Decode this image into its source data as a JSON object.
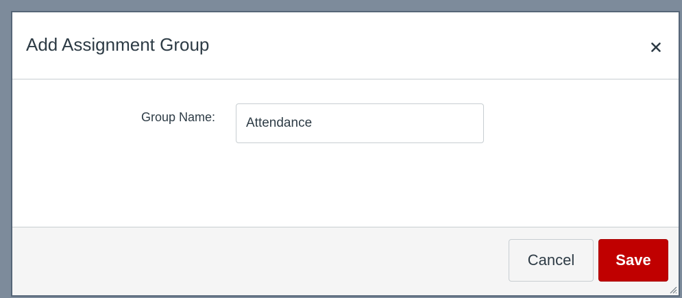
{
  "dialog": {
    "title": "Add Assignment Group",
    "close_label": "×"
  },
  "form": {
    "group_name_label": "Group Name:",
    "group_name_value": "Attendance"
  },
  "footer": {
    "cancel_label": "Cancel",
    "save_label": "Save"
  },
  "colors": {
    "save_button": "#c00000",
    "footer_background": "#f5f5f5",
    "text": "#2d3b45"
  },
  "icons": {
    "close": "close-icon",
    "resize": "resize-grip-icon"
  }
}
